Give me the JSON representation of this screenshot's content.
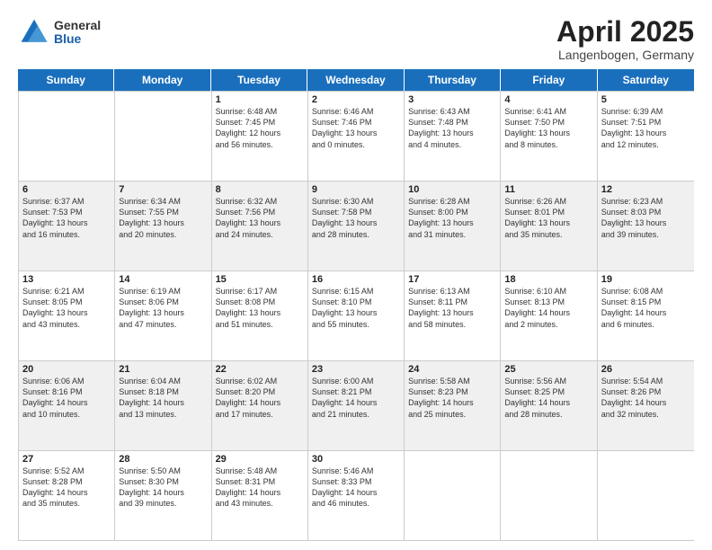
{
  "header": {
    "logo": {
      "general": "General",
      "blue": "Blue"
    },
    "title": "April 2025",
    "location": "Langenbogen, Germany"
  },
  "weekdays": [
    "Sunday",
    "Monday",
    "Tuesday",
    "Wednesday",
    "Thursday",
    "Friday",
    "Saturday"
  ],
  "rows": [
    [
      {
        "day": "",
        "info": "",
        "empty": true
      },
      {
        "day": "",
        "info": "",
        "empty": true
      },
      {
        "day": "1",
        "info": "Sunrise: 6:48 AM\nSunset: 7:45 PM\nDaylight: 12 hours\nand 56 minutes."
      },
      {
        "day": "2",
        "info": "Sunrise: 6:46 AM\nSunset: 7:46 PM\nDaylight: 13 hours\nand 0 minutes."
      },
      {
        "day": "3",
        "info": "Sunrise: 6:43 AM\nSunset: 7:48 PM\nDaylight: 13 hours\nand 4 minutes."
      },
      {
        "day": "4",
        "info": "Sunrise: 6:41 AM\nSunset: 7:50 PM\nDaylight: 13 hours\nand 8 minutes."
      },
      {
        "day": "5",
        "info": "Sunrise: 6:39 AM\nSunset: 7:51 PM\nDaylight: 13 hours\nand 12 minutes."
      }
    ],
    [
      {
        "day": "6",
        "info": "Sunrise: 6:37 AM\nSunset: 7:53 PM\nDaylight: 13 hours\nand 16 minutes.",
        "shaded": true
      },
      {
        "day": "7",
        "info": "Sunrise: 6:34 AM\nSunset: 7:55 PM\nDaylight: 13 hours\nand 20 minutes.",
        "shaded": true
      },
      {
        "day": "8",
        "info": "Sunrise: 6:32 AM\nSunset: 7:56 PM\nDaylight: 13 hours\nand 24 minutes.",
        "shaded": true
      },
      {
        "day": "9",
        "info": "Sunrise: 6:30 AM\nSunset: 7:58 PM\nDaylight: 13 hours\nand 28 minutes.",
        "shaded": true
      },
      {
        "day": "10",
        "info": "Sunrise: 6:28 AM\nSunset: 8:00 PM\nDaylight: 13 hours\nand 31 minutes.",
        "shaded": true
      },
      {
        "day": "11",
        "info": "Sunrise: 6:26 AM\nSunset: 8:01 PM\nDaylight: 13 hours\nand 35 minutes.",
        "shaded": true
      },
      {
        "day": "12",
        "info": "Sunrise: 6:23 AM\nSunset: 8:03 PM\nDaylight: 13 hours\nand 39 minutes.",
        "shaded": true
      }
    ],
    [
      {
        "day": "13",
        "info": "Sunrise: 6:21 AM\nSunset: 8:05 PM\nDaylight: 13 hours\nand 43 minutes."
      },
      {
        "day": "14",
        "info": "Sunrise: 6:19 AM\nSunset: 8:06 PM\nDaylight: 13 hours\nand 47 minutes."
      },
      {
        "day": "15",
        "info": "Sunrise: 6:17 AM\nSunset: 8:08 PM\nDaylight: 13 hours\nand 51 minutes."
      },
      {
        "day": "16",
        "info": "Sunrise: 6:15 AM\nSunset: 8:10 PM\nDaylight: 13 hours\nand 55 minutes."
      },
      {
        "day": "17",
        "info": "Sunrise: 6:13 AM\nSunset: 8:11 PM\nDaylight: 13 hours\nand 58 minutes."
      },
      {
        "day": "18",
        "info": "Sunrise: 6:10 AM\nSunset: 8:13 PM\nDaylight: 14 hours\nand 2 minutes."
      },
      {
        "day": "19",
        "info": "Sunrise: 6:08 AM\nSunset: 8:15 PM\nDaylight: 14 hours\nand 6 minutes."
      }
    ],
    [
      {
        "day": "20",
        "info": "Sunrise: 6:06 AM\nSunset: 8:16 PM\nDaylight: 14 hours\nand 10 minutes.",
        "shaded": true
      },
      {
        "day": "21",
        "info": "Sunrise: 6:04 AM\nSunset: 8:18 PM\nDaylight: 14 hours\nand 13 minutes.",
        "shaded": true
      },
      {
        "day": "22",
        "info": "Sunrise: 6:02 AM\nSunset: 8:20 PM\nDaylight: 14 hours\nand 17 minutes.",
        "shaded": true
      },
      {
        "day": "23",
        "info": "Sunrise: 6:00 AM\nSunset: 8:21 PM\nDaylight: 14 hours\nand 21 minutes.",
        "shaded": true
      },
      {
        "day": "24",
        "info": "Sunrise: 5:58 AM\nSunset: 8:23 PM\nDaylight: 14 hours\nand 25 minutes.",
        "shaded": true
      },
      {
        "day": "25",
        "info": "Sunrise: 5:56 AM\nSunset: 8:25 PM\nDaylight: 14 hours\nand 28 minutes.",
        "shaded": true
      },
      {
        "day": "26",
        "info": "Sunrise: 5:54 AM\nSunset: 8:26 PM\nDaylight: 14 hours\nand 32 minutes.",
        "shaded": true
      }
    ],
    [
      {
        "day": "27",
        "info": "Sunrise: 5:52 AM\nSunset: 8:28 PM\nDaylight: 14 hours\nand 35 minutes."
      },
      {
        "day": "28",
        "info": "Sunrise: 5:50 AM\nSunset: 8:30 PM\nDaylight: 14 hours\nand 39 minutes."
      },
      {
        "day": "29",
        "info": "Sunrise: 5:48 AM\nSunset: 8:31 PM\nDaylight: 14 hours\nand 43 minutes."
      },
      {
        "day": "30",
        "info": "Sunrise: 5:46 AM\nSunset: 8:33 PM\nDaylight: 14 hours\nand 46 minutes."
      },
      {
        "day": "",
        "info": "",
        "empty": true
      },
      {
        "day": "",
        "info": "",
        "empty": true
      },
      {
        "day": "",
        "info": "",
        "empty": true
      }
    ]
  ]
}
